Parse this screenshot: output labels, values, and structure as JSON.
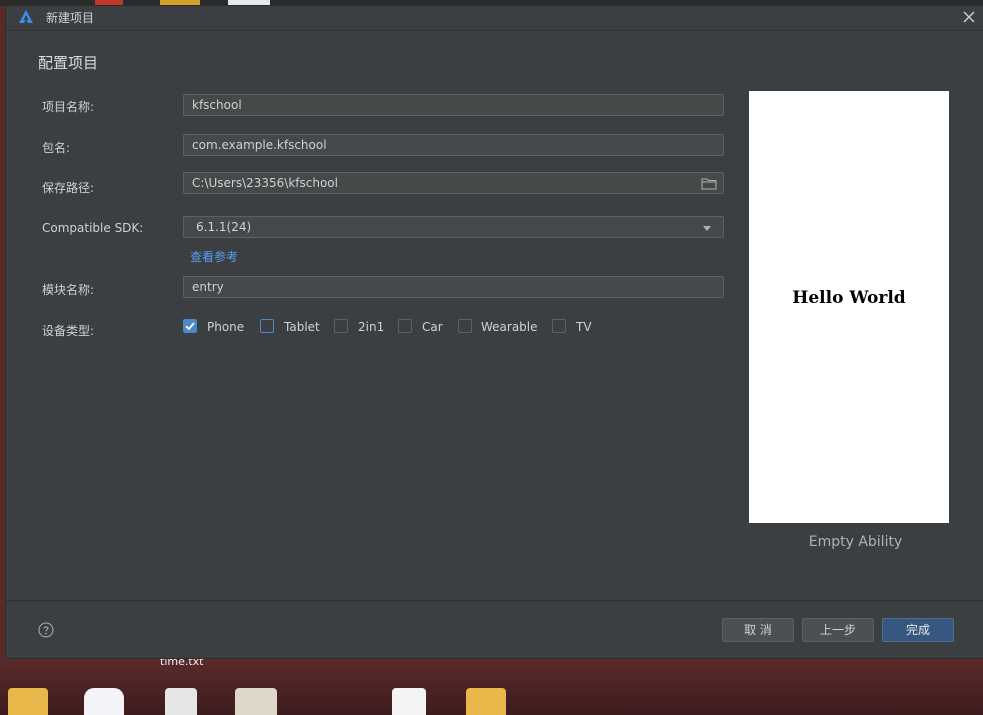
{
  "window": {
    "title": "新建项目"
  },
  "page": {
    "heading": "配置项目"
  },
  "form": {
    "project_name": {
      "label": "项目名称:",
      "value": "kfschool"
    },
    "package_name": {
      "label": "包名:",
      "value": "com.example.kfschool"
    },
    "save_path": {
      "label": "保存路径:",
      "value": "C:\\Users\\23356\\kfschool"
    },
    "sdk": {
      "label": "Compatible SDK:",
      "value": "6.1.1(24)",
      "link": "查看参考"
    },
    "module_name": {
      "label": "模块名称:",
      "value": "entry"
    },
    "device_type": {
      "label": "设备类型:",
      "options": [
        {
          "label": "Phone",
          "checked": true
        },
        {
          "label": "Tablet",
          "checked": false
        },
        {
          "label": "2in1",
          "checked": false
        },
        {
          "label": "Car",
          "checked": false
        },
        {
          "label": "Wearable",
          "checked": false
        },
        {
          "label": "TV",
          "checked": false
        }
      ]
    }
  },
  "preview": {
    "text": "Hello World",
    "caption": "Empty Ability"
  },
  "footer": {
    "cancel": "取 消",
    "previous": "上一步",
    "finish": "完成"
  },
  "desktop": {
    "file_label": "time.txt"
  },
  "colors": {
    "accent": "#4a88c7",
    "primary_button": "#365880",
    "background": "#3c3f41",
    "link": "#589df6"
  }
}
